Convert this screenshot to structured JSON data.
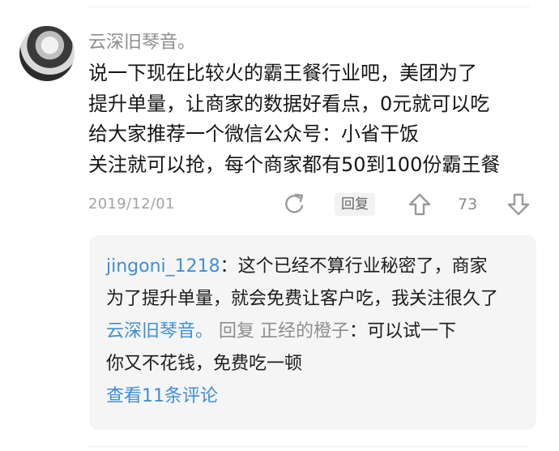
{
  "comment": {
    "author": "云深旧琴音。",
    "lines": [
      "说一下现在比较火的霸王餐行业吧，美团为了",
      "提升单量，让商家的数据好看点，0元就可以吃",
      "给大家推荐一个微信公众号：小省干饭",
      "关注就可以抢，每个商家都有50到100份霸王餐"
    ],
    "date": "2019/12/01",
    "reply_label": "回复",
    "like_count": "73"
  },
  "replies": {
    "r1_user": "jingoni_1218",
    "r1_sep": "：",
    "r1_text_a": "这个已经不算行业秘密了，商家",
    "r1_text_b": "为了提升单量，就会免费让客户吃，我关注很久了",
    "r2_user": "云深旧琴音。",
    "r2_reply_word": "回复",
    "r2_target": "正经的橙子",
    "r2_sep": "：",
    "r2_text_a": "可以试一下",
    "r2_text_b": "你又不花钱，免费吃一顿",
    "view_more": "查看11条评论"
  },
  "colors": {
    "link_blue": "#3f8fd4",
    "muted_gray": "#8e8e8e",
    "reply_bg": "#f5f5f5"
  },
  "icons": [
    "share-icon",
    "thumbs-up-arrow-icon",
    "thumbs-down-arrow-icon"
  ]
}
